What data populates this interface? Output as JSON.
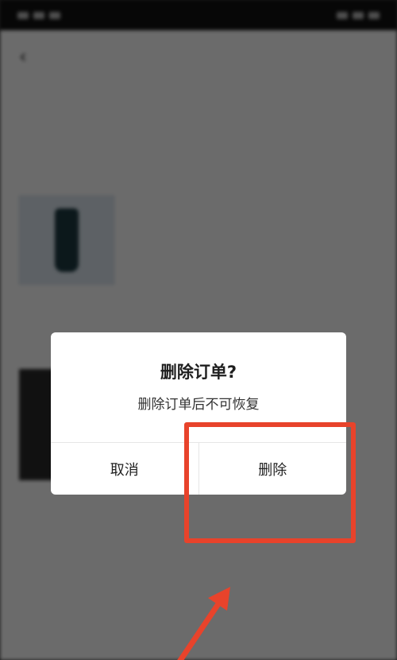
{
  "dialog": {
    "title": "删除订单?",
    "message": "删除订单后不可恢复",
    "cancel_label": "取消",
    "confirm_label": "删除"
  },
  "colors": {
    "annotation": "#e8432b",
    "overlay": "rgba(0,0,0,0.58)",
    "dialog_bg": "#ffffff"
  }
}
